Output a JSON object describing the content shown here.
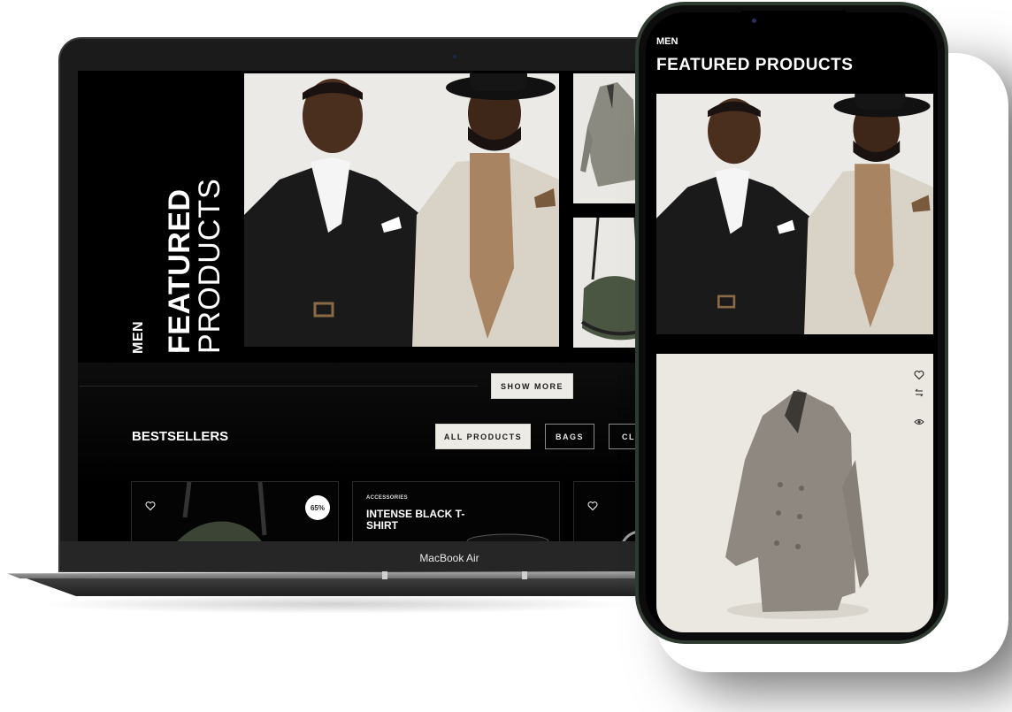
{
  "laptop": {
    "device_label": "MacBook Air",
    "hero": {
      "category": "MEN",
      "title_bold": "FEATURED",
      "title_light": "PRODUCTS"
    },
    "show_more_label": "SHOW MORE",
    "bestsellers": {
      "heading": "BESTSELLERS",
      "filters": [
        {
          "label": "ALL PRODUCTS",
          "active": true
        },
        {
          "label": "BAGS",
          "active": false
        },
        {
          "label": "CLOTHES",
          "active": false
        }
      ],
      "cards": [
        {
          "badge": "65%",
          "image": "green-duffel-bag"
        },
        {
          "category": "ACCESSORIES",
          "title": "INTENSE BLACK T-SHIRT",
          "image": "black-cap"
        },
        {
          "image": "watch"
        }
      ]
    }
  },
  "phone": {
    "category": "MEN",
    "title": "FEATURED PRODUCTS",
    "product_image": "beige-trench-coat",
    "actions": [
      "heart-icon",
      "compare-icon",
      "eye-icon"
    ]
  },
  "colors": {
    "accent_light": "#ecebe6",
    "background_dark": "#000000",
    "phone_frame": "#2f3a30"
  }
}
